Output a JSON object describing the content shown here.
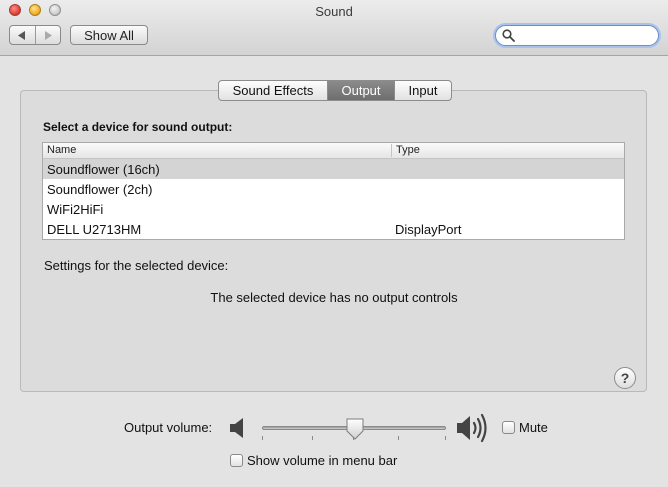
{
  "window": {
    "title": "Sound",
    "nav_back_icon": "chevron-left-icon",
    "nav_forward_icon": "chevron-right-icon",
    "show_all_label": "Show All",
    "search": {
      "value": "",
      "placeholder": ""
    }
  },
  "tabs": [
    {
      "label": "Sound Effects",
      "selected": false
    },
    {
      "label": "Output",
      "selected": true
    },
    {
      "label": "Input",
      "selected": false
    }
  ],
  "output": {
    "heading": "Select a device for sound output:",
    "columns": {
      "name": "Name",
      "type": "Type"
    },
    "devices": [
      {
        "name": "Soundflower (16ch)",
        "type": "",
        "selected": true
      },
      {
        "name": "Soundflower (2ch)",
        "type": "",
        "selected": false
      },
      {
        "name": "WiFi2HiFi",
        "type": "",
        "selected": false
      },
      {
        "name": "DELL U2713HM",
        "type": "DisplayPort",
        "selected": false
      }
    ],
    "settings_label": "Settings for the selected device:",
    "no_controls_message": "The selected device has no output controls",
    "help_label": "?"
  },
  "volume": {
    "label": "Output volume:",
    "level": 0.5,
    "mute_label": "Mute",
    "mute_checked": false,
    "show_in_menu_bar_label": "Show volume in menu bar",
    "show_in_menu_bar_checked": false
  },
  "colors": {
    "accent_focus": "#a9c3ec",
    "selected_tab": "#7a7a7a",
    "selected_row": "#d4d4d4"
  }
}
